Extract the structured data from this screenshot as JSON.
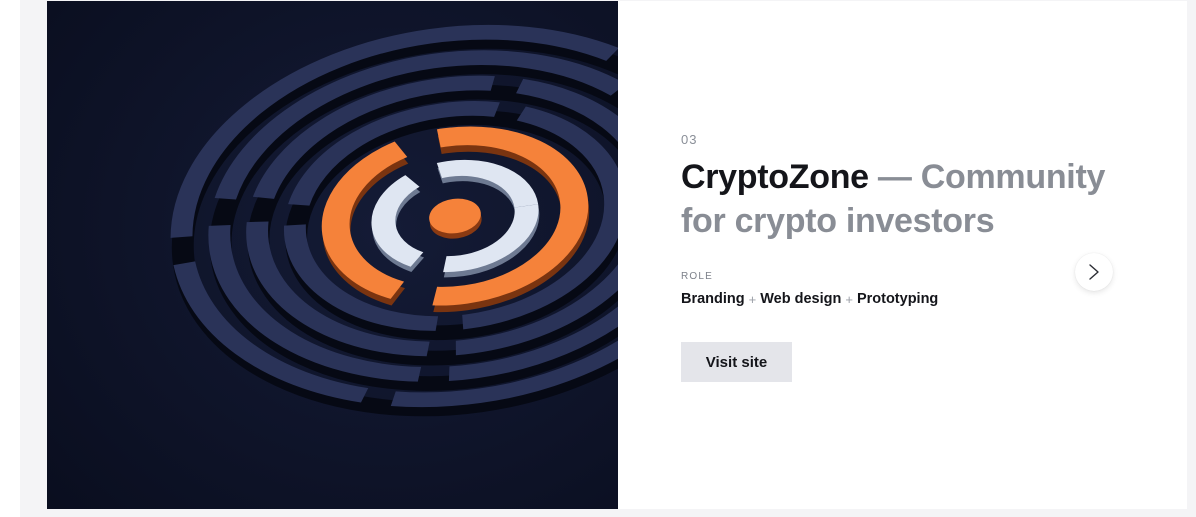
{
  "project": {
    "number": "03",
    "title_name": "CryptoZone",
    "title_rest": " — Community for crypto investors",
    "role_label": "ROLE",
    "roles": [
      "Branding",
      "Web design",
      "Prototyping"
    ],
    "role_separator": "+",
    "visit_label": "Visit site"
  },
  "icons": {
    "next": "chevron-right-icon",
    "hero": "cryptozone-logo-artwork"
  },
  "colors": {
    "hero_background": "#0e1327",
    "accent_orange": "#f5823a",
    "ring_navy": "#2a3358",
    "ring_white": "#dfe6f2",
    "button_bg": "#e4e5ea",
    "title_dark": "#14151a",
    "title_muted": "#898d95"
  }
}
